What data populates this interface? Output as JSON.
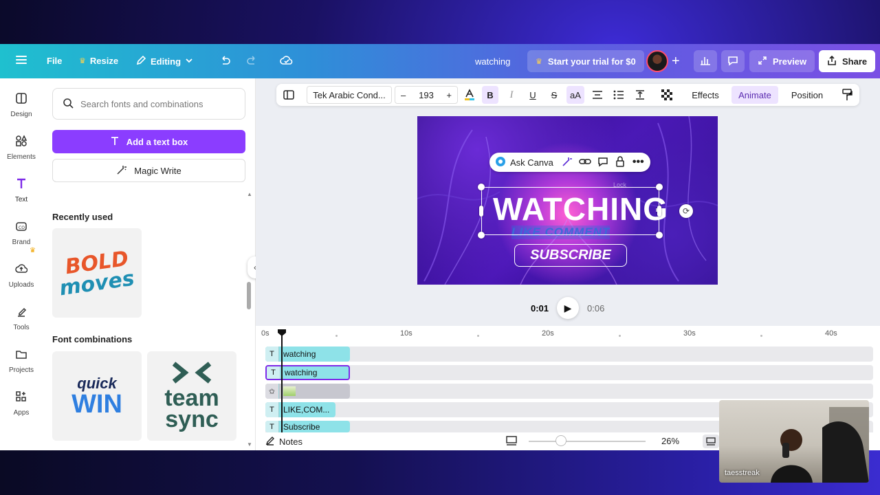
{
  "topbar": {
    "menu_icon": "hamburger-icon",
    "file_label": "File",
    "resize_label": "Resize",
    "editing_label": "Editing",
    "doc_title": "watching",
    "trial_label": "Start your trial for $0",
    "preview_label": "Preview",
    "share_label": "Share"
  },
  "rail": {
    "items": [
      {
        "label": "Design",
        "icon": "design-icon"
      },
      {
        "label": "Elements",
        "icon": "elements-icon"
      },
      {
        "label": "Text",
        "icon": "text-icon"
      },
      {
        "label": "Brand",
        "icon": "brand-icon"
      },
      {
        "label": "Uploads",
        "icon": "uploads-icon"
      },
      {
        "label": "Tools",
        "icon": "tools-icon"
      },
      {
        "label": "Projects",
        "icon": "projects-icon"
      },
      {
        "label": "Apps",
        "icon": "apps-icon"
      }
    ]
  },
  "panel": {
    "search_placeholder": "Search fonts and combinations",
    "add_text_label": "Add a text box",
    "magic_write_label": "Magic Write",
    "recently_used_title": "Recently used",
    "recent_line1": "BOLD",
    "recent_line2": "moves",
    "font_combinations_title": "Font combinations",
    "combo1_line1": "quick",
    "combo1_line2": "WIN",
    "combo2_line1": "team",
    "combo2_line2": "sync",
    "watermark": "taesstreak"
  },
  "toolbar": {
    "font_name": "Tek Arabic Cond...",
    "font_size": "193",
    "minus": "–",
    "plus": "+",
    "bold": "B",
    "italic": "I",
    "underline": "U",
    "strike": "S",
    "case": "aA",
    "effects_label": "Effects",
    "animate_label": "Animate",
    "position_label": "Position"
  },
  "canvas": {
    "ask_canva_label": "Ask Canva",
    "lock_tooltip": "Lock",
    "headline": "WATCHING",
    "subline": "LIKE COMMENT",
    "subscribe_label": "SUBSCRIBE"
  },
  "playback": {
    "current_time": "0:01",
    "total_time": "0:06"
  },
  "timeline": {
    "ruler": [
      "0s",
      "10s",
      "20s",
      "30s",
      "40s"
    ],
    "clips": [
      {
        "label": "watching",
        "type": "text"
      },
      {
        "label": "watching",
        "type": "text",
        "selected": true
      },
      {
        "label": "",
        "type": "image"
      },
      {
        "label": "LIKE,COM...",
        "type": "text"
      },
      {
        "label": "Subscribe",
        "type": "text"
      }
    ]
  },
  "bottombar": {
    "notes_label": "Notes",
    "zoom_value": "26%"
  },
  "webcam": {
    "name": "taesstreak"
  },
  "colors": {
    "accent": "#8b3dff",
    "topbar_start": "#1fc0cf",
    "topbar_end": "#7a4fe4",
    "clip": "#8ee2e8"
  }
}
